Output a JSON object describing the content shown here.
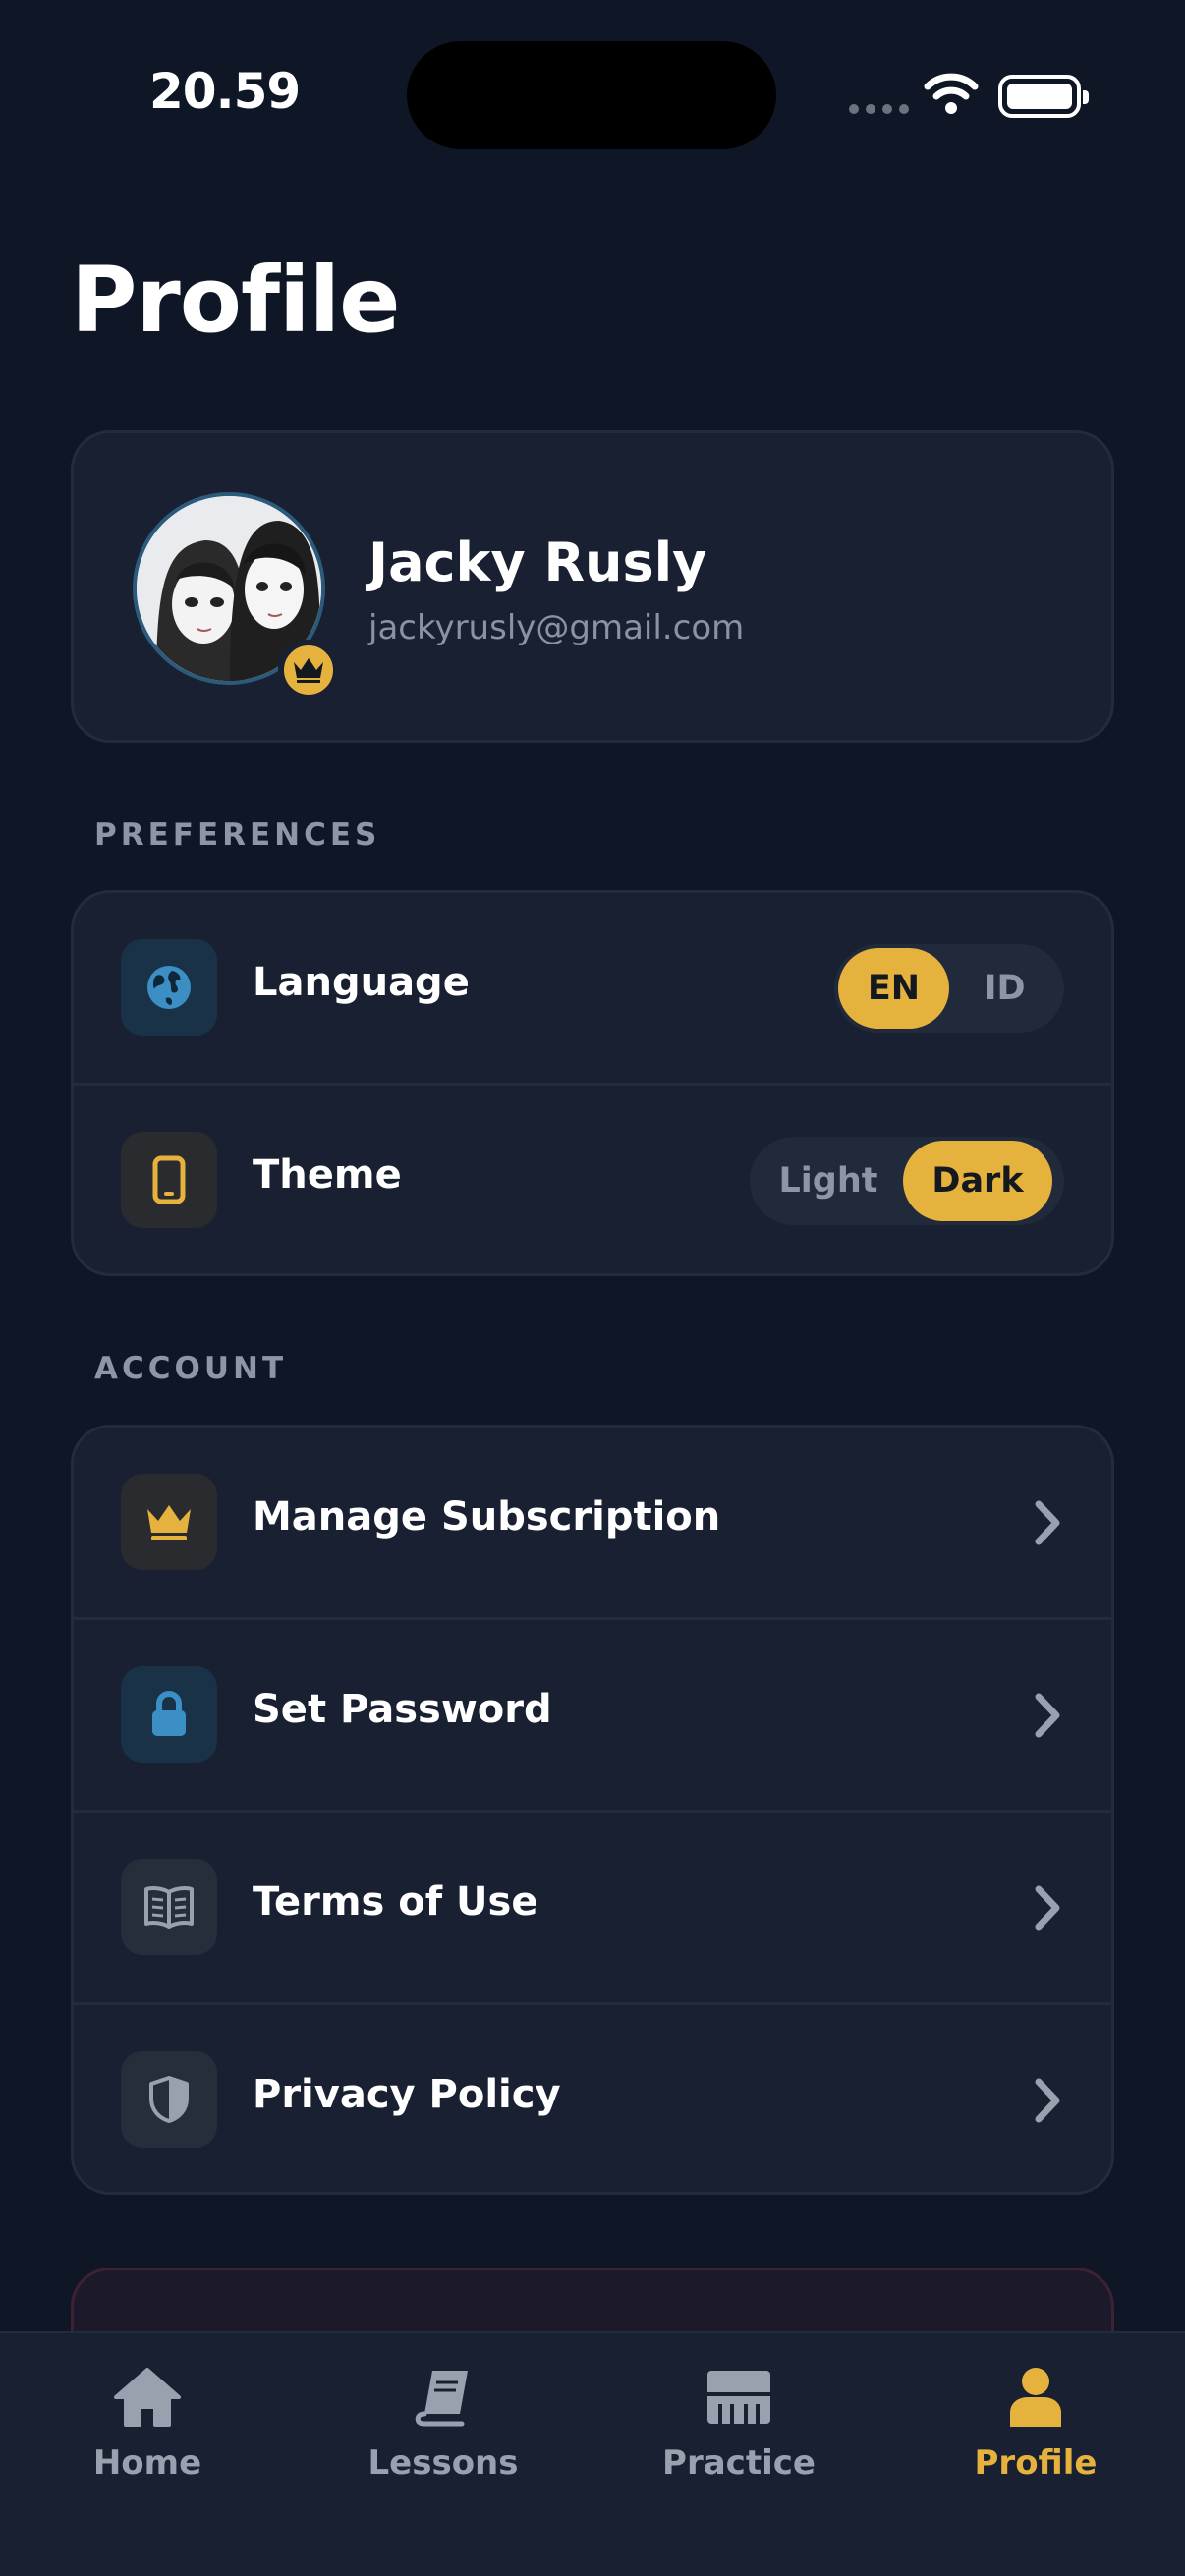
{
  "status_bar": {
    "time": "20.59"
  },
  "page": {
    "title": "Profile"
  },
  "profile": {
    "name": "Jacky Rusly",
    "email": "jackyrusly@gmail.com"
  },
  "preferences": {
    "section_label": "PREFERENCES",
    "language": {
      "label": "Language",
      "options": [
        "EN",
        "ID"
      ],
      "selected": "EN",
      "icon": "globe-icon"
    },
    "theme": {
      "label": "Theme",
      "options": [
        "Light",
        "Dark"
      ],
      "selected": "Dark",
      "icon": "phone-icon"
    }
  },
  "account": {
    "section_label": "ACCOUNT",
    "items": [
      {
        "label": "Manage Subscription",
        "icon": "crown-icon"
      },
      {
        "label": "Set Password",
        "icon": "lock-icon"
      },
      {
        "label": "Terms of Use",
        "icon": "book-open-icon"
      },
      {
        "label": "Privacy Policy",
        "icon": "shield-icon"
      }
    ]
  },
  "tabs": [
    {
      "label": "Home",
      "icon": "home-icon",
      "active": false
    },
    {
      "label": "Lessons",
      "icon": "book-icon",
      "active": false
    },
    {
      "label": "Practice",
      "icon": "piano-icon",
      "active": false
    },
    {
      "label": "Profile",
      "icon": "person-icon",
      "active": true
    }
  ],
  "colors": {
    "background": "#0f1626",
    "card": "#182031",
    "accent": "#e6b23e",
    "blue": "#3b8fc4"
  }
}
